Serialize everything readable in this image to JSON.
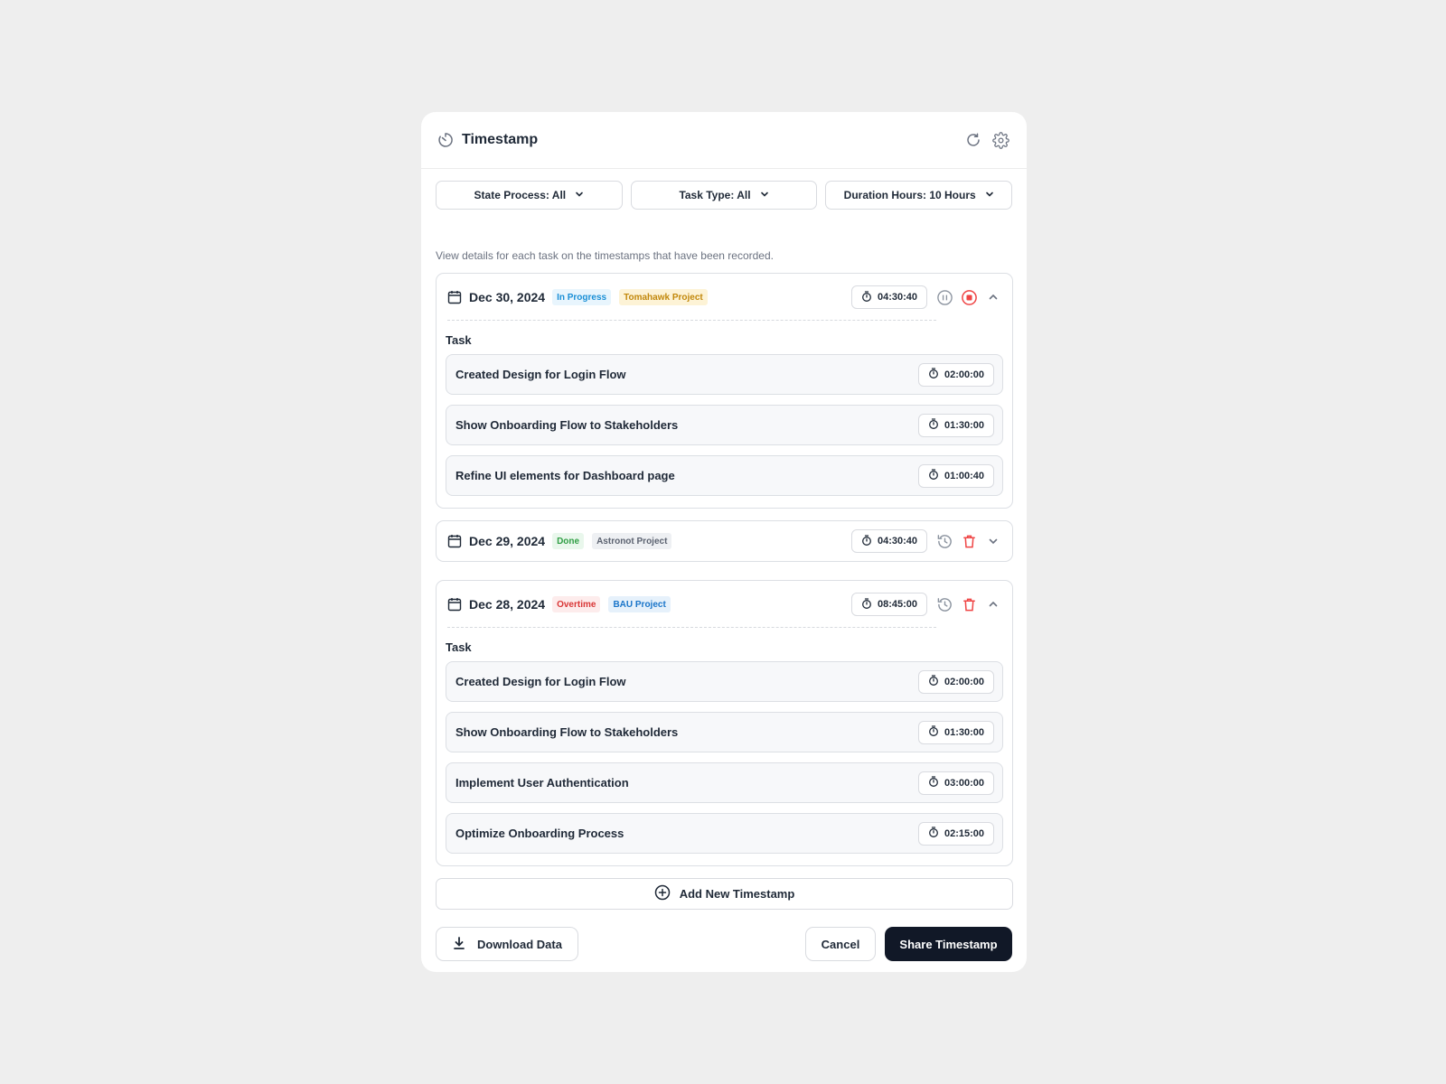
{
  "header": {
    "title": "Timestamp",
    "icon": "clock-icon"
  },
  "filters": {
    "state": "State Process: All",
    "task_type": "Task Type: All",
    "duration": "Duration Hours: 10 Hours"
  },
  "description": "View details for each task on the timestamps that have been recorded.",
  "task_label": "Task",
  "entries": [
    {
      "date": "Dec 30, 2024",
      "status": "In Progress",
      "project": "Tomahawk Project",
      "total": "04:30:40",
      "expanded": true,
      "tasks": [
        {
          "name": "Created Design for Login Flow",
          "time": "02:00:00"
        },
        {
          "name": "Show Onboarding Flow to Stakeholders",
          "time": "01:30:00"
        },
        {
          "name": "Refine UI elements for Dashboard page",
          "time": "01:00:40"
        }
      ]
    },
    {
      "date": "Dec 29, 2024",
      "status": "Done",
      "project": "Astronot Project",
      "total": "04:30:40",
      "expanded": false,
      "tasks": []
    },
    {
      "date": "Dec 28, 2024",
      "status": "Overtime",
      "project": "BAU Project",
      "total": "08:45:00",
      "expanded": true,
      "tasks": [
        {
          "name": "Created Design for Login Flow",
          "time": "02:00:00"
        },
        {
          "name": "Show Onboarding Flow to Stakeholders",
          "time": "01:30:00"
        },
        {
          "name": "Implement User Authentication",
          "time": "03:00:00"
        },
        {
          "name": "Optimize Onboarding Process",
          "time": "02:15:00"
        }
      ]
    }
  ],
  "add_button": "Add New Timestamp",
  "footer": {
    "download": "Download Data",
    "cancel": "Cancel",
    "share": "Share Timestamp"
  },
  "colors": {
    "primary": "#111827",
    "danger": "#ef4444",
    "muted_icon": "#8a929e"
  }
}
